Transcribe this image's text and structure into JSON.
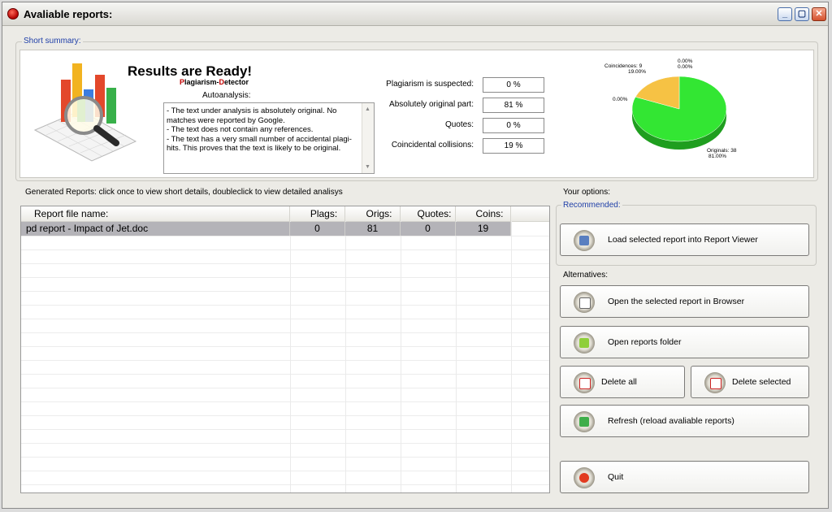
{
  "window": {
    "title": "Avaliable reports:",
    "controls": [
      "minimize-icon",
      "maximize-icon",
      "close-icon"
    ]
  },
  "summary": {
    "group_label": "Short summary:",
    "heading": "Results are Ready!",
    "brand_p": "P",
    "brand_lagiarism": "lagiarism-",
    "brand_d": "D",
    "brand_etector": "etector",
    "autoanalysis_label": "Autoanalysis:",
    "autoanalysis_text": " - The text under analysis is absolutely original. No matches were reported by Google.\n - The text does not contain any references.\n - The text has a very small number of accidental plagi-hits. This proves that the text is likely to be original.",
    "stats": [
      {
        "label": "Plagiarism is suspected:",
        "value": "0 %"
      },
      {
        "label": "Absolutely original part:",
        "value": "81 %"
      },
      {
        "label": "Quotes:",
        "value": "0 %"
      },
      {
        "label": "Coincidental collisions:",
        "value": "19 %"
      }
    ]
  },
  "chart_data": {
    "type": "pie",
    "slices": [
      {
        "label": "Originals: 38",
        "percent_label": "81.00%",
        "value": 81,
        "color": "#33e633"
      },
      {
        "label": "Coincidences: 9",
        "percent_label": "19.00%",
        "value": 19,
        "color": "#f6c244"
      },
      {
        "label": "",
        "percent_label": "0.00%",
        "value": 0,
        "color": "#e03030"
      },
      {
        "label": "",
        "percent_label": "0.00%",
        "value": 0,
        "color": "#3060e0"
      },
      {
        "label": "",
        "percent_label": "0.00%",
        "value": 0,
        "color": "#a0a0a0"
      }
    ]
  },
  "reports": {
    "caption": "Generated Reports: click once to view short details, doubleclick to view detailed analisys",
    "columns": [
      "Report file name:",
      "Plags:",
      "Origs:",
      "Quotes:",
      "Coins:"
    ],
    "rows": [
      {
        "name": "pd report - Impact of Jet.doc",
        "plags": "0",
        "origs": "81",
        "quotes": "0",
        "coins": "19"
      }
    ]
  },
  "options": {
    "caption": "Your options:",
    "recommended_label": "Recommended:",
    "load_report": "Load selected report into Report Viewer",
    "alternatives_label": "Alternatives:",
    "open_browser": "Open the selected report in Browser",
    "open_folder": "Open reports folder",
    "delete_all": "Delete all",
    "delete_selected": "Delete selected",
    "refresh": "Refresh (reload avaliable reports)",
    "quit": "Quit"
  },
  "colors": {
    "accent_label": "#1f3fa8",
    "brand_red": "#c00000",
    "pie_green": "#33e633",
    "pie_orange": "#f6c244"
  }
}
